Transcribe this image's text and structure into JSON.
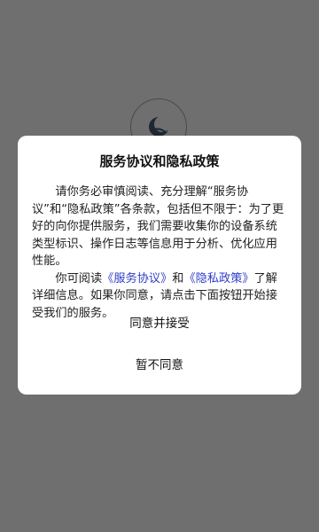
{
  "dialog": {
    "title": "服务协议和隐私政策",
    "paragraph1": "请你务必审慎阅读、充分理解“服务协议”和“隐私政策”各条款，包括但不限于：为了更好的向你提供服务，我们需要收集你的设备系统类型标识、操作日志等信息用于分析、优化应用性能。",
    "paragraph2_prefix": "你可阅读",
    "service_link": "《服务协议》",
    "and_text": "和",
    "privacy_link": "《隐私政策》",
    "paragraph2_suffix": "了解详细信息。如果你同意，请点击下面按钮开始接受我们的服务。",
    "agree_label": "同意并接受",
    "disagree_label": "暂不同意"
  },
  "colors": {
    "overlay": "#6f6f6f",
    "link": "#2f3cc7"
  },
  "icons": {
    "app_logo": "app-logo-icon"
  }
}
